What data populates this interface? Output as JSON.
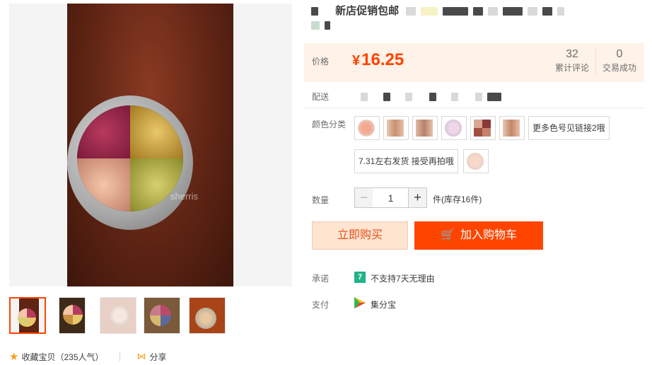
{
  "gallery": {
    "watermark": "sherris",
    "thumbnails": [
      {
        "name": "thumb-1",
        "bg": "#5e2414",
        "circle": "#b86a4a"
      },
      {
        "name": "thumb-2",
        "bg": "#3d2a18",
        "circle": "#d6a84a"
      },
      {
        "name": "thumb-3",
        "bg": "#e8d0c6",
        "circle": "#f0e0d8"
      },
      {
        "name": "thumb-4",
        "bg": "#7a5a3a",
        "circle": "#b84a6a"
      },
      {
        "name": "thumb-5",
        "bg": "#a84418",
        "circle": "#e8c8a0"
      }
    ]
  },
  "actions": {
    "collect_label": "收藏宝贝",
    "collect_count": "（235人气）",
    "share_label": "分享"
  },
  "title": {
    "text": "新店促销包邮"
  },
  "price": {
    "label": "价格",
    "currency": "¥",
    "value": "16.25",
    "reviews_count": "32",
    "reviews_label": "累计评论",
    "deals_count": "0",
    "deals_label": "交易成功"
  },
  "shipping": {
    "label": "配送"
  },
  "color": {
    "label": "颜色分类",
    "more_label": "更多色号见链接2哦",
    "ship_note": "7.31左右发货 接受再拍哦"
  },
  "quantity": {
    "label": "数量",
    "minus": "−",
    "value": "1",
    "plus": "+",
    "stock": "件(库存16件)"
  },
  "buttons": {
    "buy_now": "立即购买",
    "add_cart": "加入购物车"
  },
  "promise": {
    "label": "承诺",
    "icon_text": "7",
    "text": "不支持7天无理由"
  },
  "payment": {
    "label": "支付",
    "text": "集分宝"
  },
  "colors": {
    "accent": "#ff4400",
    "price_bg": "#fff2e8"
  }
}
